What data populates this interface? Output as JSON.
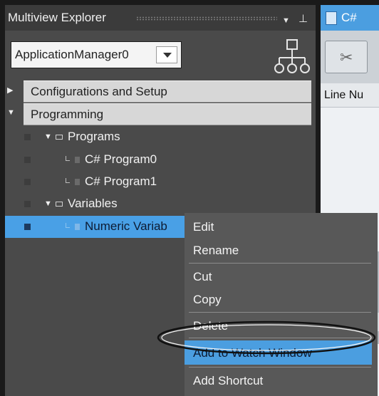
{
  "explorer": {
    "title": "Multiview Explorer",
    "pane_dropdown_icon": "pane-menu-dropdown-icon",
    "pin_icon": "pin-icon",
    "device_select": {
      "value": "ApplicationManager0"
    },
    "hierarchy_icon": "hierarchy-tree-icon",
    "categories": [
      {
        "label": "Configurations and Setup",
        "expanded": false
      },
      {
        "label": "Programming",
        "expanded": true
      }
    ],
    "tree": {
      "programs": "Programs",
      "program0": "C# Program0",
      "program1": "C# Program1",
      "variables": "Variables",
      "numeric_variable": "Numeric Variab"
    }
  },
  "editor": {
    "tab_label": "C#",
    "column_header": "Line Nu"
  },
  "context_menu": {
    "items": [
      "Edit",
      "Rename",
      "Cut",
      "Copy",
      "Delete",
      "Add to Watch Window",
      "Add Shortcut"
    ],
    "highlighted": "Add to Watch Window"
  },
  "colors": {
    "selection": "#49a0e6",
    "menu_bg": "#585858",
    "panel_bg": "#4a4a4a",
    "accent_tab": "#4b9ee0"
  }
}
